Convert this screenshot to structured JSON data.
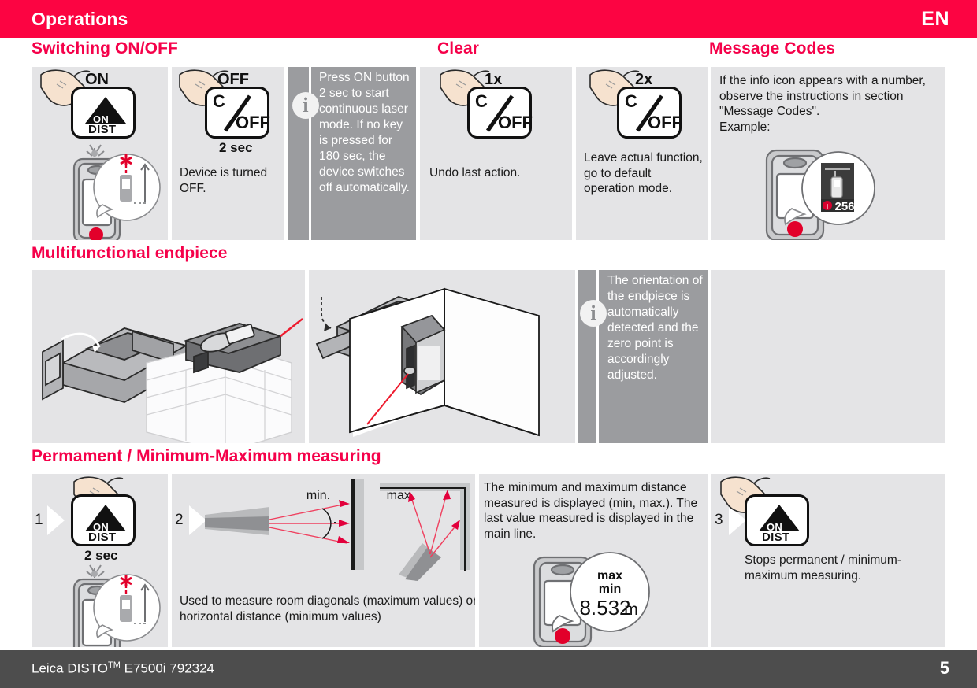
{
  "header": {
    "title": "Operations",
    "language": "EN",
    "accent_color": "#fc0442"
  },
  "sections": [
    {
      "id": "switching",
      "title": "Switching ON/OFF"
    },
    {
      "id": "clear",
      "title": "Clear"
    },
    {
      "id": "message_codes",
      "title": "Message Codes"
    },
    {
      "id": "endpiece",
      "title": "Multifunctional endpiece"
    },
    {
      "id": "minmax",
      "title": "Permament / Minimum-Maximum measuring"
    }
  ],
  "row1": {
    "cell_on": {
      "top_label": "ON",
      "key_triangle_label": "ON",
      "key_sub_label": "DIST"
    },
    "cell_off": {
      "top_label": "OFF",
      "key_c": "C",
      "key_off": "OFF",
      "duration": "2 sec",
      "caption": "Device is turned OFF."
    },
    "cell_info": {
      "icon": "info-icon",
      "text": "Press ON button 2 sec to start continuous laser mode. If no key is pressed for 180 sec, the device switches off automatically."
    },
    "cell_1x": {
      "top_label": "1x",
      "key_c": "C",
      "key_off": "OFF",
      "caption": "Undo last action."
    },
    "cell_2x": {
      "top_label": "2x",
      "key_c": "C",
      "key_off": "OFF",
      "caption": "Leave actual function, go to default operation mode."
    },
    "cell_message": {
      "text": "If the info icon appears with a number, observe the instructions in section \"Message Codes\".\nExample:",
      "display_code": "256"
    }
  },
  "row2": {
    "cell_a": {
      "illustration": "endpiece-flip-and-brick-wall"
    },
    "cell_b": {
      "illustration": "endpiece-rotate-and-corner-measure"
    },
    "cell_info": {
      "icon": "info-icon",
      "text": "The orientation of the endpiece is automatically detected and the zero point is accordingly adjusted."
    },
    "cell_blank": {
      "illustration": ""
    }
  },
  "row3": {
    "step1": {
      "index": "1",
      "key_triangle_label": "ON",
      "key_sub_label": "DIST",
      "duration": "2 sec"
    },
    "step2": {
      "index": "2",
      "label_min": "min.",
      "label_max": "max.",
      "caption": "Used to measure room diagonals (maximum values) or horizontal distance (minimum values)"
    },
    "cell_text": {
      "text": "The minimum and maximum distance measured is displayed (min, max.). The last value measured is displayed in the main line.",
      "display_max": "max",
      "display_min": "min",
      "display_value": "8.532",
      "display_unit": "m"
    },
    "step3": {
      "index": "3",
      "key_triangle_label": "ON",
      "key_sub_label": "DIST",
      "caption": "Stops permanent / minimum-maximum measuring."
    }
  },
  "footer": {
    "product": "Leica DISTO",
    "tm": "TM",
    "model": " E7500i 792324",
    "page_number": "5"
  }
}
